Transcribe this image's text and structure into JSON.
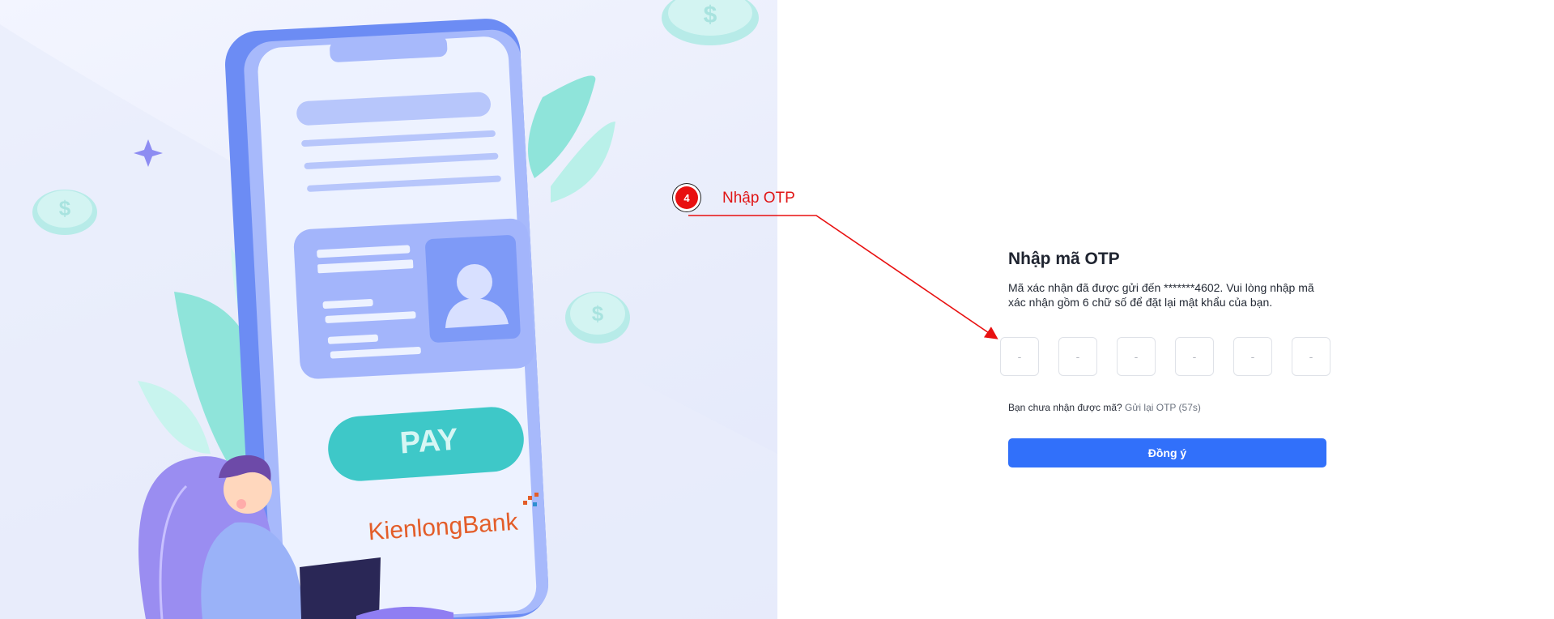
{
  "illustration": {
    "pay_label": "PAY",
    "brand_logo_text": "KienlongBank",
    "colors": {
      "phone": "#7f9cf5",
      "screen": "#edf2ff",
      "card": "#a3b5fb",
      "pay_button": "#3ec8c8",
      "logo_orange": "#e35d29",
      "logo_blue": "#2e8fd0",
      "leaf": "#7fe0d6",
      "coin": "#c6efee"
    }
  },
  "otp": {
    "title": "Nhập mã OTP",
    "description": "Mã xác nhận đã được gửi đến *******4602. Vui lòng nhập mã xác nhận gồm 6 chữ số để đặt lại mật khẩu của bạn.",
    "box_placeholder": "-",
    "resend_prompt": "Bạn chưa nhận được mã?",
    "resend_link": "Gửi lại OTP (57s)",
    "submit_label": "Đồng ý",
    "colors": {
      "primary": "#3170fa",
      "box_border": "#dfe2e8"
    }
  },
  "annotation": {
    "step_number": "4",
    "label": "Nhập OTP",
    "color": "#e81010"
  }
}
